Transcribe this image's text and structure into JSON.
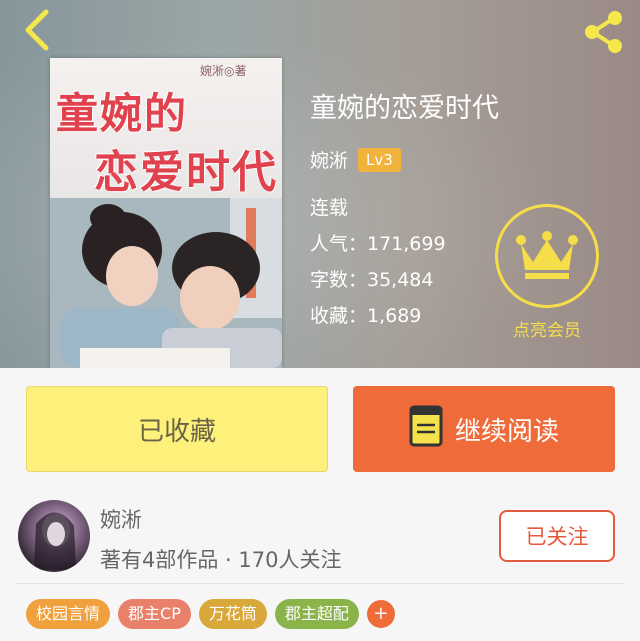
{
  "book": {
    "title": "童婉的恋爱时代",
    "author": "婉淅",
    "level": "Lv3",
    "status": "连载",
    "popularity": "人气：171,699",
    "word_count": "字数：35,484",
    "favorites": "收藏：1,689"
  },
  "cover": {
    "author_mark": "婉淅◎著",
    "title_line1": "童婉的",
    "title_line2": "恋爱时代"
  },
  "vip": {
    "label": "点亮会员"
  },
  "actions": {
    "favorited_label": "已收藏",
    "continue_label": "继续阅读"
  },
  "writer": {
    "name": "婉淅",
    "stats": "著有4部作品 · 170人关注",
    "follow_label": "已关注"
  },
  "tags": [
    {
      "label": "校园言情",
      "color": "#f0a03c"
    },
    {
      "label": "郡主CP",
      "color": "#e8806a"
    },
    {
      "label": "万花筒",
      "color": "#d9a83a"
    },
    {
      "label": "郡主超配",
      "color": "#8ab44a"
    }
  ],
  "tag_more": "+",
  "icons": {
    "back": "chevron-left-icon",
    "share": "share-icon",
    "crown": "crown-icon",
    "book": "book-icon"
  },
  "colors": {
    "accent": "#ef6b3a",
    "favorite_bg": "#fdf17c",
    "vip": "#f6de4a",
    "follow": "#e35a3c"
  }
}
